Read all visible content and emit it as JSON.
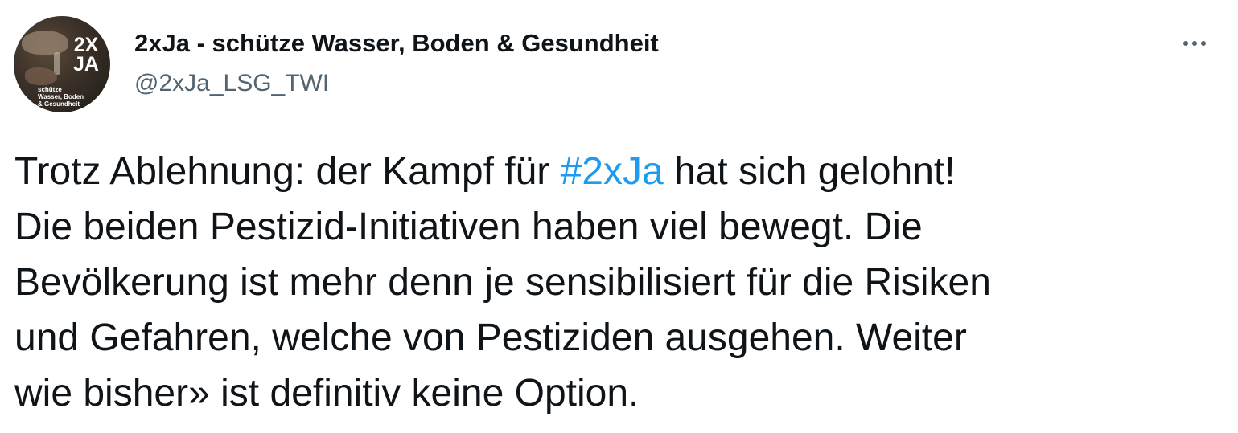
{
  "author": {
    "display_name": "2xJa - schütze Wasser, Boden & Gesundheit",
    "handle": "@2xJa_LSG_TWI",
    "avatar_logo": {
      "big_line1": "2X",
      "big_line2": "JA",
      "small_line1": "schütze",
      "small_line2": "Wasser, Boden",
      "small_line3": "& Gesundheit"
    }
  },
  "more_button": {
    "icon": "more-horizontal-icon"
  },
  "tweet": {
    "line1_before": "Trotz Ablehnung: der Kampf für ",
    "hashtag": "#2xJa",
    "line1_after": " hat sich gelohnt!",
    "line2": "Die beiden Pestizid-Initiativen haben viel bewegt. Die",
    "line3": "Bevölkerung ist mehr denn je sensibilisiert für die Risiken",
    "line4": "und Gefahren, welche von Pestiziden ausgehen. Weiter",
    "line5": "wie bisher» ist definitiv keine Option."
  },
  "colors": {
    "hashtag": "#1d9bf0",
    "text_primary": "#0f1419",
    "text_secondary": "#536471"
  }
}
